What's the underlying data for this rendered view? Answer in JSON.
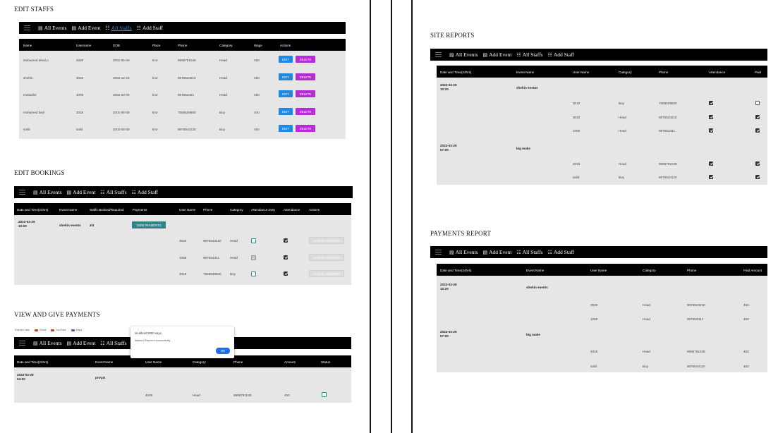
{
  "nav_items": [
    "All Events",
    "Add Event",
    "All Staffs",
    "Add Staff"
  ],
  "edit_staffs": {
    "heading": "EDIT STAFFS",
    "columns": [
      "Name",
      "Username",
      "DOB",
      "Place",
      "Phone",
      "Category",
      "Wage",
      "Actions"
    ],
    "rows": [
      [
        "Mohamed afeal p",
        "4049",
        "2001-05-09",
        "tirur",
        "9995791049",
        "Head",
        "450"
      ],
      [
        "shehin",
        "3020",
        "2002-12-23",
        "tirur",
        "9876543210",
        "Head",
        "450"
      ],
      [
        "mubashir",
        "1059",
        "2002-03-05",
        "tirur",
        "987654321",
        "Head",
        "450"
      ],
      [
        "mohamed fasil",
        "3019",
        "2001-05-09",
        "tirur",
        "7558539600",
        "Boy",
        "400"
      ],
      [
        "sahil",
        "sahil",
        "2003-06-09",
        "tirur",
        "8976543120",
        "Boy",
        "450"
      ]
    ],
    "edit_label": "EDIT",
    "delete_label": "DELETE"
  },
  "edit_bookings": {
    "heading": "EDIT  BOOKINGS",
    "columns": [
      "Date and Time(24hrs)",
      "Event Name",
      "Staffs Booked/Required",
      "Payments",
      "User Name",
      "Phone",
      "Category",
      "Attendance Duty",
      "Attendance",
      "Actions"
    ],
    "event": {
      "date": "2023-03-29",
      "time": "10:20",
      "name": "shehin events",
      "booked": "3/4"
    },
    "view_payments_label": "VIEW PAYMENTS",
    "cancel_label": "CANCEL BOOKING",
    "rows": [
      {
        "user": "3020",
        "phone": "9876543210",
        "category": "Head",
        "duty": "unchecked",
        "attendance": true
      },
      {
        "user": "1059",
        "phone": "987654321",
        "category": "Head",
        "duty": "disabled",
        "attendance": true
      },
      {
        "user": "3019",
        "phone": "7558539600",
        "category": "Boy",
        "duty": "unchecked",
        "attendance": true
      }
    ]
  },
  "view_payments": {
    "heading": "VIEW AND GIVE PAYMENTS",
    "bookmarks": [
      "Refresh Lists",
      "Gmail",
      "YouTube",
      "Maps"
    ],
    "columns": [
      "Date and Time(24hrs)",
      "Event Name",
      "User Name",
      "Category",
      "Phone",
      "Amount",
      "Status"
    ],
    "event": {
      "date": "2023-03-29",
      "time": "04:00",
      "name": "proyat"
    },
    "rows": [
      {
        "user": "4049",
        "category": "Head",
        "phone": "9995791049",
        "amount": "450"
      }
    ],
    "dialog": {
      "title": "localhost:3000 says",
      "message": "Marked Payment successfully",
      "ok": "OK"
    }
  },
  "site_reports": {
    "heading": "SITE REPORTS",
    "columns": [
      "Date and Time(24hrs)",
      "Event Name",
      "User Name",
      "Category",
      "Phone",
      "Attendance",
      "Paid"
    ],
    "groups": [
      {
        "date": "2023-03-29",
        "time": "10:20",
        "event": "shehin events",
        "rows": [
          {
            "user": "3019",
            "category": "Boy",
            "phone": "7558539600",
            "attendance": true,
            "paid": false
          },
          {
            "user": "3020",
            "category": "Head",
            "phone": "9876543210",
            "attendance": true,
            "paid": true
          },
          {
            "user": "1059",
            "category": "Head",
            "phone": "987654321",
            "attendance": true,
            "paid": true
          }
        ]
      },
      {
        "date": "2023-03-29",
        "time": "07:00",
        "event": "big make",
        "rows": [
          {
            "user": "4049",
            "category": "Head",
            "phone": "9995791049",
            "attendance": true,
            "paid": true
          },
          {
            "user": "sahil",
            "category": "Boy",
            "phone": "8976543120",
            "attendance": true,
            "paid": true
          }
        ]
      }
    ]
  },
  "payments_report": {
    "heading": "PAYMENTS REPORT",
    "columns": [
      "Date and Time(24hrs)",
      "Event Name",
      "User Name",
      "Category",
      "Phone",
      "Paid Amount"
    ],
    "groups": [
      {
        "date": "2023-03-29",
        "time": "10:20",
        "event": "shehin events",
        "rows": [
          {
            "user": "3020",
            "category": "Head",
            "phone": "9876543210",
            "amount": "450"
          },
          {
            "user": "1059",
            "category": "Head",
            "phone": "987654321",
            "amount": "450"
          }
        ]
      },
      {
        "date": "2023-03-29",
        "time": "07:00",
        "event": "big make",
        "rows": [
          {
            "user": "4049",
            "category": "Head",
            "phone": "9995791049",
            "amount": "450"
          },
          {
            "user": "sahil",
            "category": "Boy",
            "phone": "8976543120",
            "amount": "450"
          }
        ]
      }
    ]
  }
}
